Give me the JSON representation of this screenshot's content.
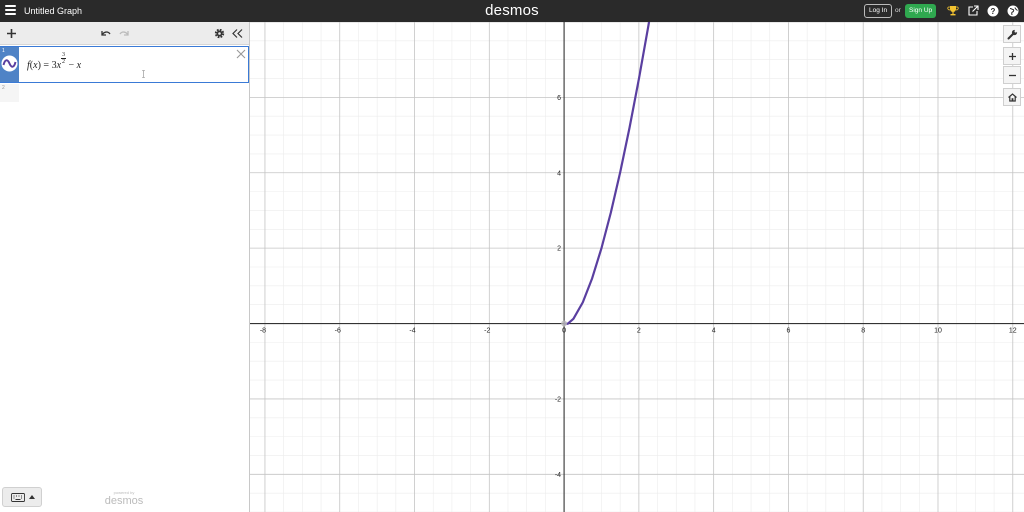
{
  "app": {
    "graph_title": "Untitled Graph",
    "brand": "desmos",
    "login_label": "Log In",
    "or_label": "or",
    "signup_label": "Sign Up",
    "accent_green": "#2fa84f",
    "topbar_color": "#2a2a2a",
    "icons": [
      "menu-icon",
      "trophy-icon",
      "share-icon",
      "help-icon",
      "globe-icon"
    ]
  },
  "panel": {
    "header_icons": [
      "add-icon",
      "undo-icon",
      "redo-icon",
      "settings-icon",
      "collapse-icon"
    ],
    "expressions": [
      {
        "index": "1",
        "latex_display": "f(x) = 3x^(3/2) − x",
        "f": "f",
        "var": "x",
        "coef": "3",
        "exp_num": "3",
        "exp_den": "2",
        "color": "#5a3fa0"
      },
      {
        "index": "2",
        "latex_display": ""
      }
    ],
    "powered_by": "powered by",
    "powered_brand": "desmos"
  },
  "graph_controls": [
    "wrench-icon",
    "zoom-in-icon",
    "zoom-out-icon",
    "home-icon"
  ],
  "chart_data": {
    "type": "line",
    "title": "",
    "xlabel": "",
    "ylabel": "",
    "xlim": [
      -8.4,
      12.3
    ],
    "ylim": [
      -5.0,
      8.0
    ],
    "x_ticks": [
      -8,
      -6,
      -4,
      -2,
      0,
      2,
      4,
      6,
      8,
      10,
      12
    ],
    "y_ticks": [
      -4,
      -2,
      2,
      4,
      6
    ],
    "grid": true,
    "series": [
      {
        "expression": "f(x) = 3x^(3/2) - x",
        "color": "#5a3fa0",
        "x": [
          0,
          0.1,
          0.25,
          0.5,
          0.75,
          1.0,
          1.25,
          1.5,
          1.75,
          2.0,
          2.25,
          2.4
        ],
        "y": [
          0,
          -0.005,
          0.125,
          0.561,
          1.199,
          2.0,
          2.943,
          4.011,
          5.195,
          6.485,
          7.875,
          8.753
        ]
      }
    ]
  }
}
